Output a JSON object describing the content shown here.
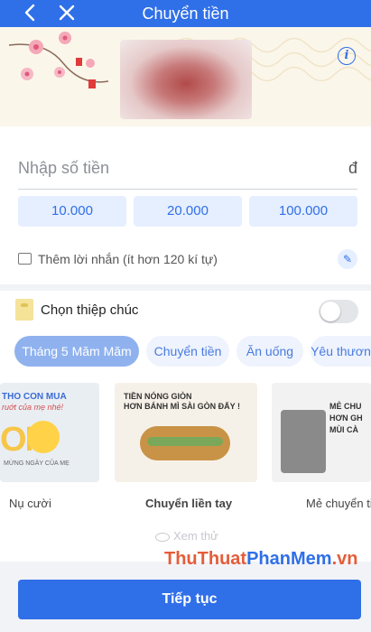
{
  "header": {
    "title": "Chuyển tiền"
  },
  "amount": {
    "placeholder": "Nhập số tiền",
    "currency": "đ"
  },
  "quick_amounts": [
    "10.000",
    "20.000",
    "100.000"
  ],
  "message": {
    "label": "Thêm lời nhắn (ít hơn 120 kí tự)"
  },
  "greeting_card": {
    "label": "Chọn thiệp chúc",
    "toggle_on": false
  },
  "categories": [
    "Tháng 5 Măm Măm",
    "Chuyển tiền",
    "Ăn uống",
    "Yêu thươn"
  ],
  "active_category": 0,
  "cards": [
    {
      "caption": "Nụ cười",
      "line1": "THO CON MUA",
      "line2": "ruớt của mẹ nhé!",
      "big": "OM",
      "line3": "MỪNG NGÀY CỦA MẸ"
    },
    {
      "caption": "Chuyển liền tay",
      "line1": "TIỀN NÓNG GIÒN",
      "line2": "HƠN BÁNH MÌ SÀI GÒN ĐẤY !"
    },
    {
      "caption": "Mẻ chuyển tiề",
      "line1": "MẺ CHU",
      "line2": "HƠN GH",
      "line3": "MÙI CÀ"
    }
  ],
  "preview": {
    "label": "Xem thử"
  },
  "watermark": {
    "part1": "ThuThuat",
    "part2": "PhanMem",
    "part3": ".vn"
  },
  "footer": {
    "continue_label": "Tiếp tục"
  }
}
